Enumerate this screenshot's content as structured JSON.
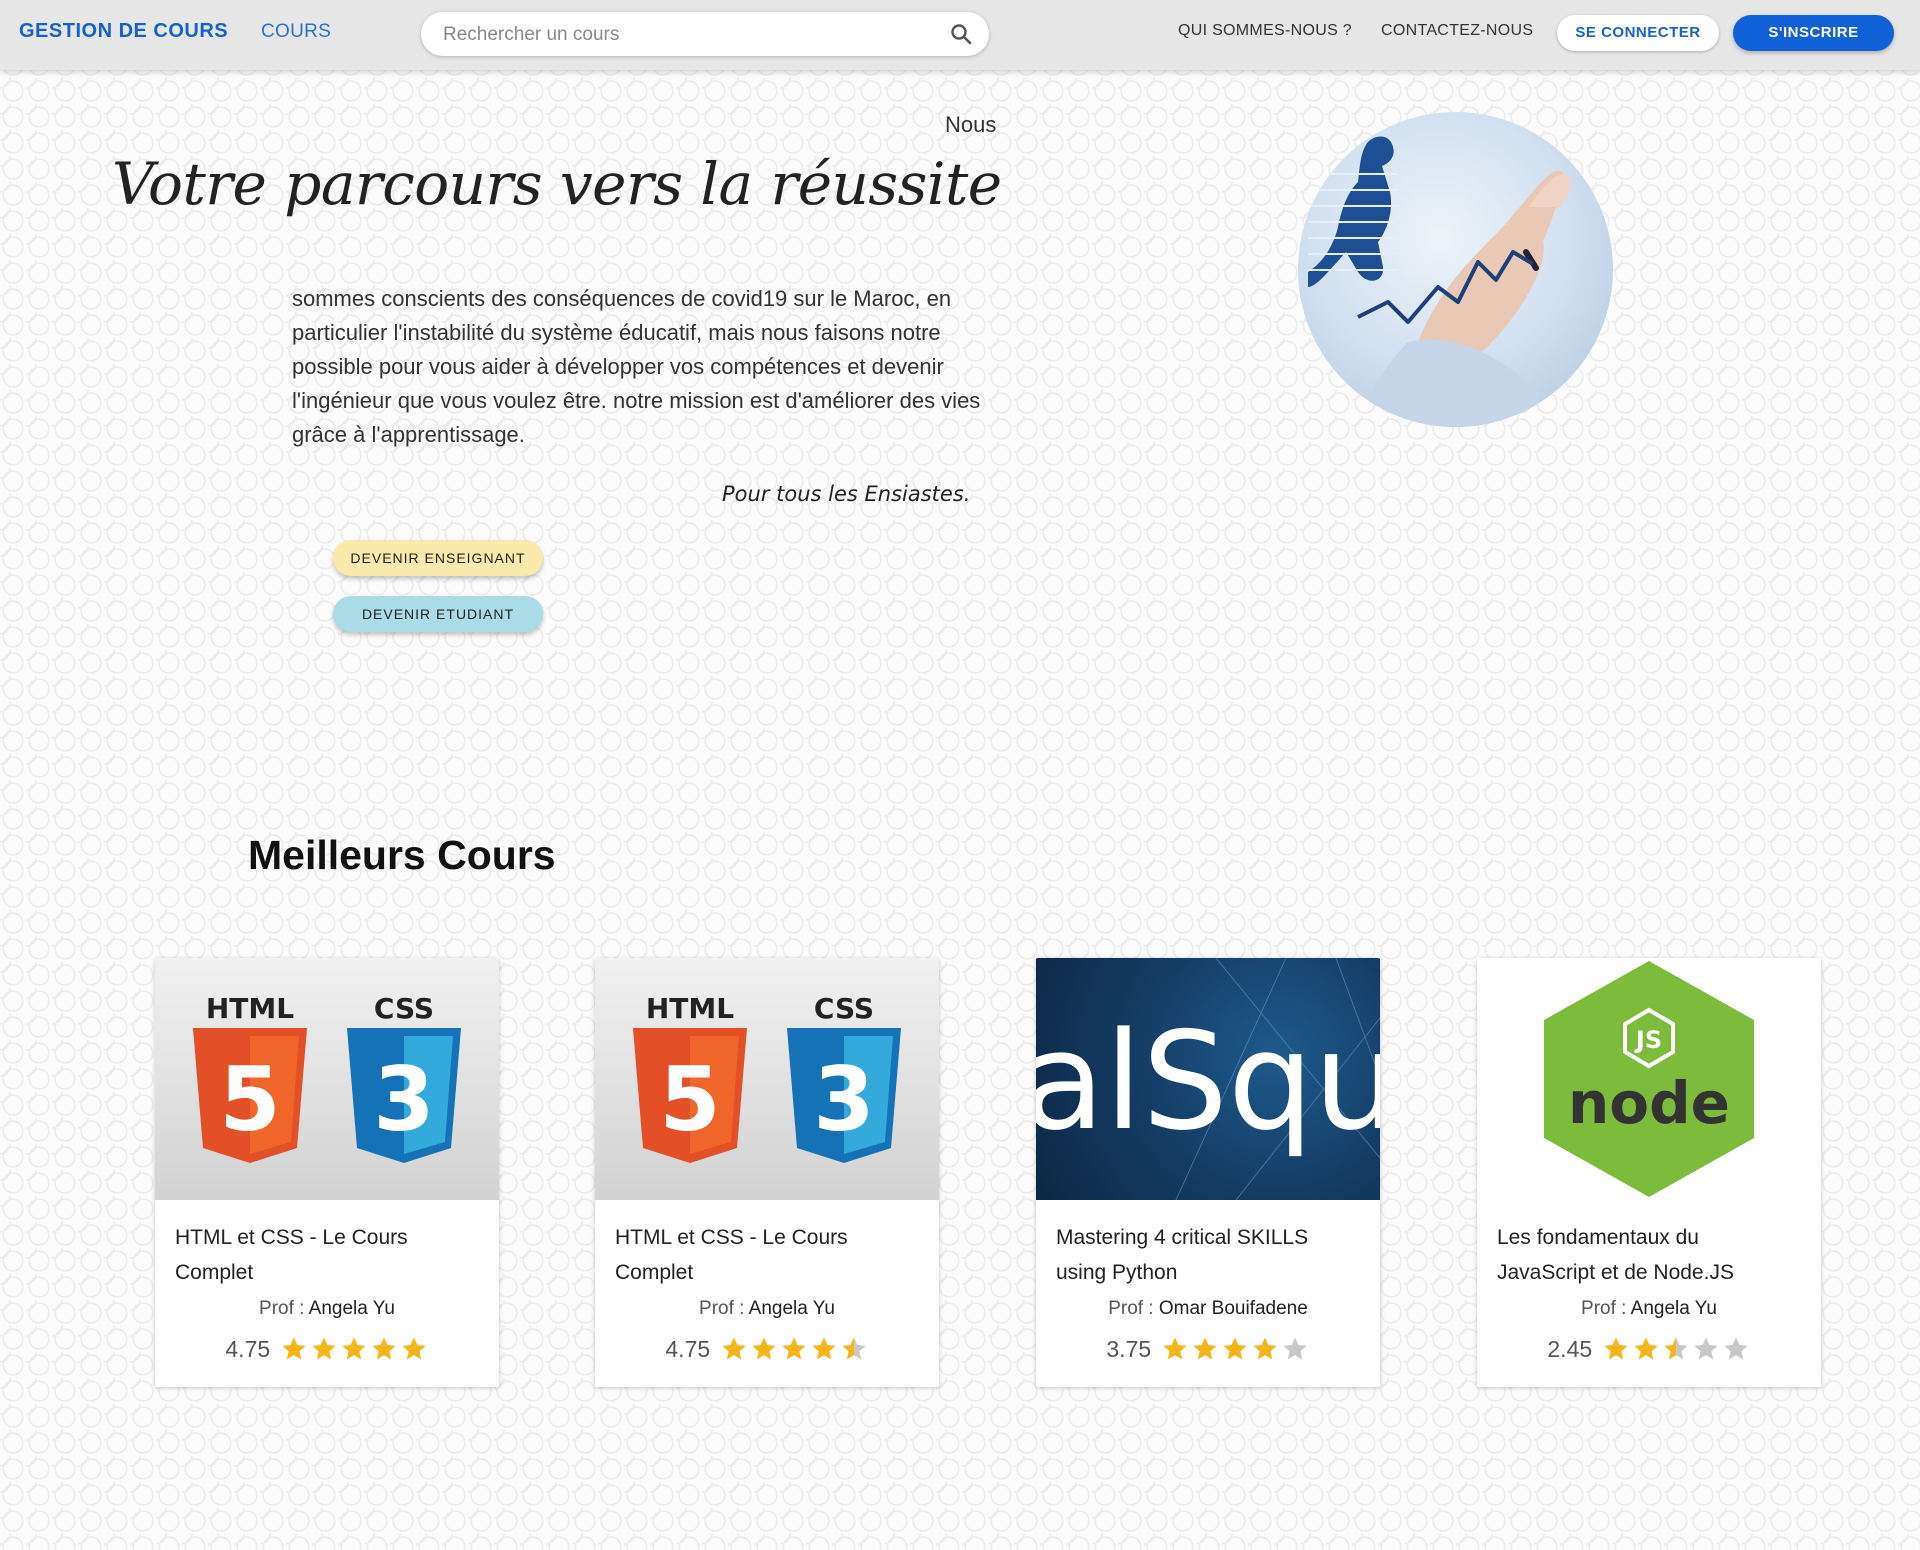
{
  "nav": {
    "brand": "GESTION DE COURS",
    "cours": "COURS",
    "search_placeholder": "Rechercher un cours",
    "about": "QUI SOMMES-NOUS ?",
    "contact": "CONTACTEZ-NOUS",
    "login": "SE CONNECTER",
    "signup": "S'INSCRIRE"
  },
  "hero": {
    "nous": "Nous",
    "title": "Votre parcours vers la réussite",
    "paragraph": "sommes conscients des conséquences de covid19 sur le Maroc, en particulier l'instabilité du système éducatif, mais nous faisons notre possible pour vous aider à développer vos compétences et devenir l'ingénieur que vous voulez être. notre mission est d'améliorer des vies grâce à l'apprentissage.",
    "signature": "Pour tous les Ensiastes.",
    "teacher_button": "DEVENIR ENSEIGNANT",
    "student_button": "DEVENIR ETUDIANT"
  },
  "section": {
    "title": "Meilleurs Cours"
  },
  "courses": [
    {
      "title": "HTML et CSS - Le Cours Complet",
      "prof_label": "Prof :",
      "prof": "Angela Yu",
      "rating": "4.75",
      "rating_value": 5,
      "image": "html-css-logo"
    },
    {
      "title": "HTML et CSS - Le Cours Complet",
      "prof_label": "Prof :",
      "prof": "Angela Yu",
      "rating": "4.75",
      "rating_value": 4.5,
      "image": "html-css-logo"
    },
    {
      "title": "Mastering 4 critical SKILLS using Python",
      "prof_label": "Prof :",
      "prof": "Omar Bouifadene",
      "rating": "3.75",
      "rating_value": 4,
      "image": "sql-banner",
      "image_text": "alSqu"
    },
    {
      "title": "Les fondamentaux du JavaScript et de Node.JS",
      "prof_label": "Prof :",
      "prof": "Angela Yu",
      "rating": "2.45",
      "rating_value": 2.5,
      "image": "nodejs-logo"
    }
  ],
  "logos": {
    "html": "HTML",
    "css": "CSS",
    "html_num": "5",
    "css_num": "3",
    "js": "JS",
    "node": "node"
  },
  "colors": {
    "brand": "#1660d0",
    "star": "#f5b51a",
    "star_empty": "#c8c8c8",
    "teacher": "#fbe9ab",
    "student": "#abdbe6"
  }
}
